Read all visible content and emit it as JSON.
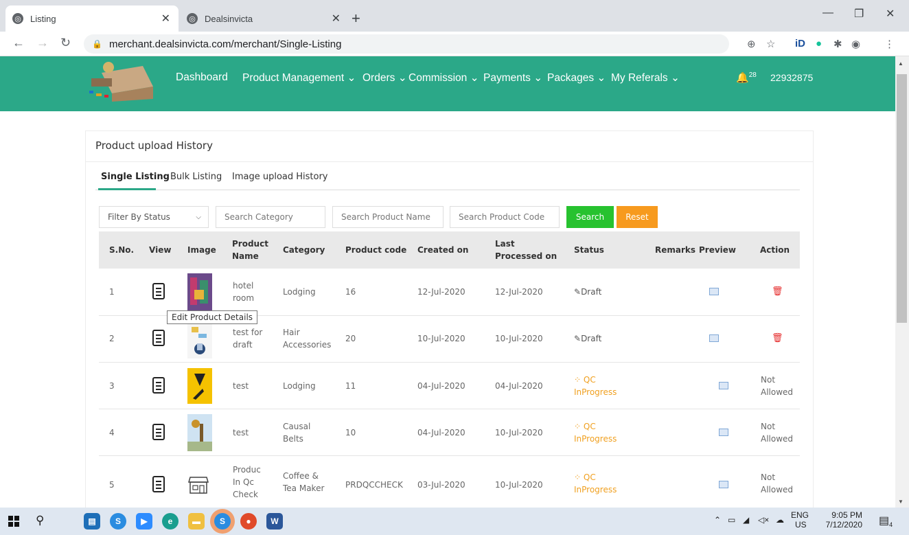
{
  "browser": {
    "tabs": [
      {
        "title": "Listing",
        "active": true
      },
      {
        "title": "Dealsinvicta",
        "active": false
      }
    ],
    "url": "merchant.dealsinvicta.com/merchant/Single-Listing"
  },
  "site": {
    "nav": [
      "Dashboard",
      "Product Management",
      "Orders",
      "Commission",
      "Payments",
      "Packages",
      "My Referals"
    ],
    "notification_count": "28",
    "user_id": "22932875",
    "brand_color": "#2ba888"
  },
  "page": {
    "title": "Product upload History",
    "tabs": [
      "Single Listing",
      "Bulk Listing",
      "Image upload History"
    ],
    "filters": {
      "status_select": "Filter By Status",
      "category_placeholder": "Search Category",
      "name_placeholder": "Search Product Name",
      "code_placeholder": "Search Product Code",
      "search_label": "Search",
      "reset_label": "Reset"
    },
    "columns": [
      "S.No.",
      "View",
      "Image",
      "Product Name",
      "Category",
      "Product code",
      "Created on",
      "Last Processed on",
      "Status",
      "Remarks",
      "Preview",
      "Action"
    ],
    "tooltip": "Edit Product Details",
    "rows": [
      {
        "sno": "1",
        "name": "hotel room",
        "category": "Lodging",
        "code": "16",
        "created": "12-Jul-2020",
        "processed": "12-Jul-2020",
        "status": "Draft",
        "action": "delete"
      },
      {
        "sno": "2",
        "name": "test for draft",
        "category": "Hair Accessories",
        "code": "20",
        "created": "10-Jul-2020",
        "processed": "10-Jul-2020",
        "status": "Draft",
        "action": "delete"
      },
      {
        "sno": "3",
        "name": "test",
        "category": "Lodging",
        "code": "11",
        "created": "04-Jul-2020",
        "processed": "04-Jul-2020",
        "status": "QC InProgress",
        "action": "Not Allowed"
      },
      {
        "sno": "4",
        "name": "test",
        "category": "Causal Belts",
        "code": "10",
        "created": "04-Jul-2020",
        "processed": "10-Jul-2020",
        "status": "QC InProgress",
        "action": "Not Allowed"
      },
      {
        "sno": "5",
        "name": "Produc In Qc Check",
        "category": "Coffee & Tea Maker",
        "code": "PRDQCCHECK",
        "created": "03-Jul-2020",
        "processed": "10-Jul-2020",
        "status": "QC InProgress",
        "action": "Not Allowed"
      }
    ]
  },
  "taskbar": {
    "lang": "ENG",
    "region": "US",
    "time": "9:05 PM",
    "date": "7/12/2020",
    "notifications": "4"
  }
}
